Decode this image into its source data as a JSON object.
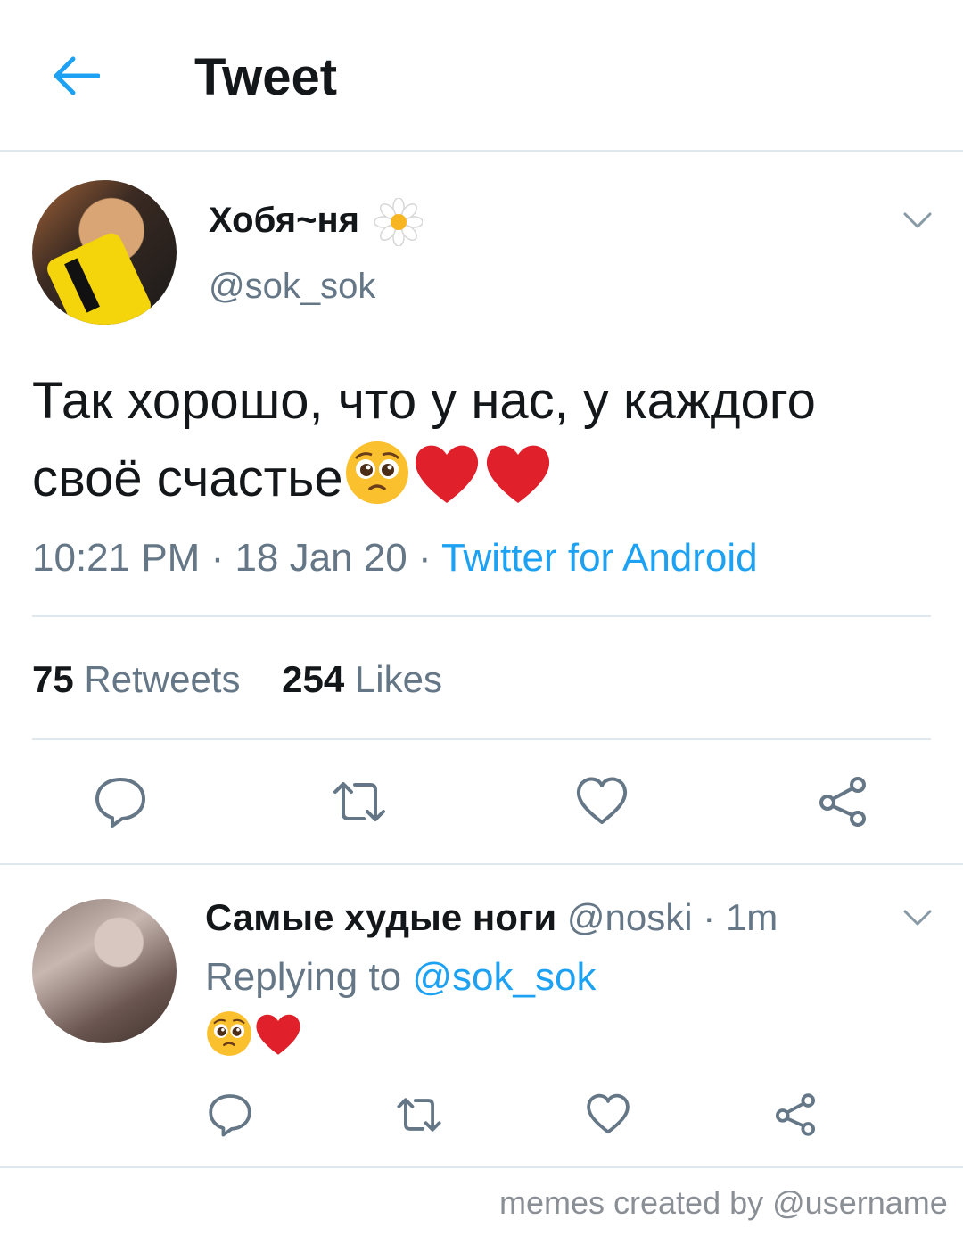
{
  "header": {
    "title": "Tweet"
  },
  "tweet": {
    "author_name": "Хобя~ня",
    "author_handle": "@sok_sok",
    "text_line1": "Так хорошо, что у нас, у каждого",
    "text_line2": "своё счастье",
    "time": "10:21 PM",
    "date": "18 Jan 20",
    "separator": " · ",
    "source": "Twitter for Android",
    "retweets_count": "75",
    "retweets_label": "Retweets",
    "likes_count": "254",
    "likes_label": "Likes"
  },
  "reply": {
    "author_name": "Самые худые ноги",
    "author_handle": "@noski",
    "age": "1m",
    "replying_prefix": "Replying to",
    "replying_handle": "@sok_sok"
  },
  "watermark": "memes created by @username",
  "colors": {
    "accent": "#1da1f2",
    "muted": "#657786",
    "heart": "#e0202a",
    "emoji": "#fbc02d"
  }
}
